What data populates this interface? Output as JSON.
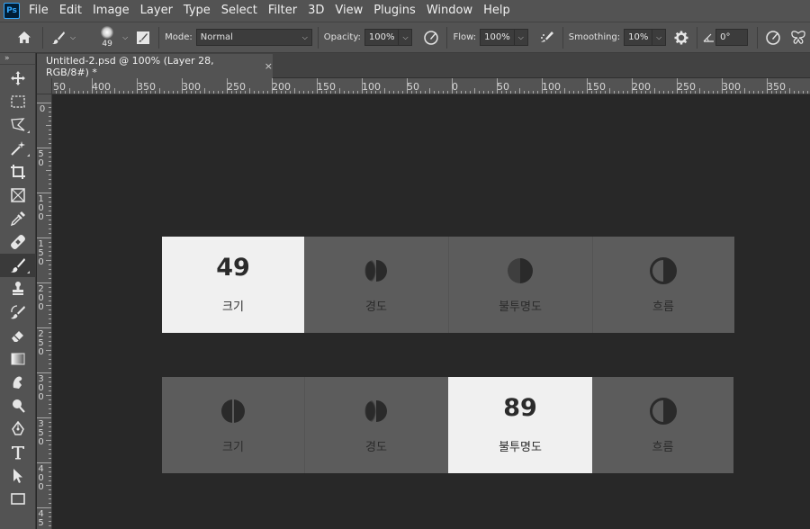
{
  "menubar": {
    "logo": "Ps",
    "items": [
      "File",
      "Edit",
      "Image",
      "Layer",
      "Type",
      "Select",
      "Filter",
      "3D",
      "View",
      "Plugins",
      "Window",
      "Help"
    ]
  },
  "options": {
    "brush_size": "49",
    "mode_label": "Mode:",
    "mode_value": "Normal",
    "opacity_label": "Opacity:",
    "opacity_value": "100%",
    "flow_label": "Flow:",
    "flow_value": "100%",
    "smoothing_label": "Smoothing:",
    "smoothing_value": "10%",
    "angle_value": "0°"
  },
  "document": {
    "tab_title": "Untitled-2.psd @ 100% (Layer 28, RGB/8#) *",
    "close": "×"
  },
  "rulers": {
    "horizontal": [
      "50",
      "400",
      "350",
      "300",
      "250",
      "200",
      "150",
      "100",
      "50",
      "0",
      "50",
      "100",
      "150",
      "200",
      "250",
      "300",
      "350"
    ],
    "vertical": [
      "0",
      "5 0",
      "1 0 0",
      "1 5 0",
      "2 0 0",
      "2 5 0",
      "3 0 0",
      "3 5 0",
      "4 0 0",
      "4 5"
    ]
  },
  "widgets": {
    "row1": [
      {
        "label": "크기",
        "value": "49",
        "icon": "number",
        "selected": true
      },
      {
        "label": "경도",
        "icon": "half-circle-hardness-icon",
        "selected": false
      },
      {
        "label": "불투명도",
        "icon": "half-circle-opacity-icon",
        "selected": false
      },
      {
        "label": "흐름",
        "icon": "half-circle-flow-icon",
        "selected": false
      }
    ],
    "row2": [
      {
        "label": "크기",
        "icon": "half-circle-size-icon",
        "selected": false
      },
      {
        "label": "경도",
        "icon": "half-circle-hardness-icon",
        "selected": false
      },
      {
        "label": "불투명도",
        "value": "89",
        "icon": "number",
        "selected": true
      },
      {
        "label": "흐름",
        "icon": "half-circle-flow-icon",
        "selected": false
      }
    ]
  },
  "colors": {
    "ui_bg": "#535353",
    "canvas_bg": "#282828",
    "cell_bg": "#5c5c5c",
    "cell_selected": "#f0f0f0",
    "accent": "#31a8ff"
  }
}
